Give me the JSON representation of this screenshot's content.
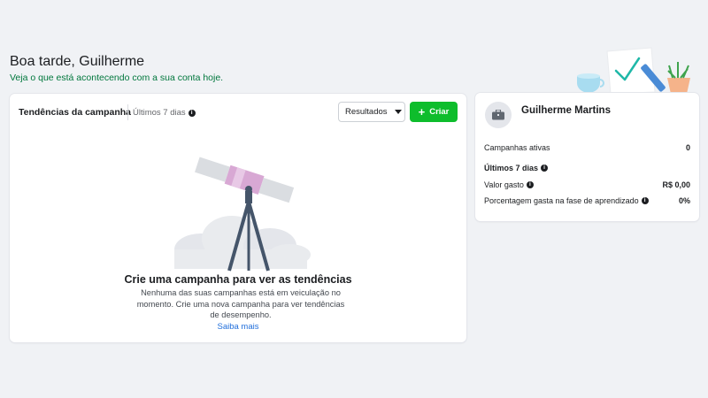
{
  "greeting": {
    "title": "Boa tarde, Guilherme",
    "subtitle": "Veja o que está acontecendo com a sua conta hoje."
  },
  "trends": {
    "title": "Tendências da campanha",
    "range": "Últimos 7 dias",
    "select_value": "Resultados",
    "create_label": "Criar",
    "empty_title": "Crie uma campanha para ver as tendências",
    "empty_desc": "Nenhuma das suas campanhas está em veiculação no momento. Crie uma nova campanha para ver tendências de desempenho.",
    "learn_more": "Saiba mais"
  },
  "account": {
    "name": "Guilherme Martins",
    "active_label": "Campanhas ativas",
    "active_value": "0",
    "period_label": "Últimos 7 dias",
    "spent_label": "Valor gasto",
    "spent_value": "R$ 0,00",
    "learning_label": "Porcentagem gasta na fase de aprendizado",
    "learning_value": "0%"
  },
  "colors": {
    "accent_green": "#0ebd2c",
    "subtitle_green": "#00773c",
    "link_blue": "#216fdb"
  },
  "icons": [
    "info-icon",
    "chevron-down-icon",
    "plus-icon",
    "briefcase-icon",
    "telescope-illustration",
    "checklist-illustration"
  ]
}
